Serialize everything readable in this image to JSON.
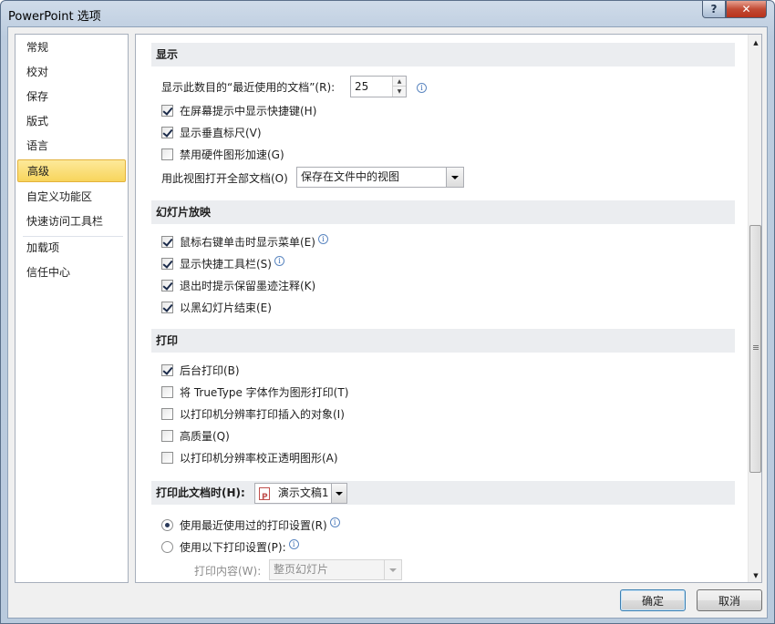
{
  "window": {
    "title": "PowerPoint 选项",
    "help_label": "?",
    "close_label": "✕"
  },
  "nav": {
    "items": [
      "常规",
      "校对",
      "保存",
      "版式",
      "语言",
      "高级",
      "自定义功能区",
      "快速访问工具栏",
      "加载项",
      "信任中心"
    ],
    "active": "高级"
  },
  "display": {
    "heading": "显示",
    "recent_docs_label": "显示此数目的“最近使用的文档”(R):",
    "recent_docs_value": "25",
    "options": [
      {
        "label": "在屏幕提示中显示快捷键(H)",
        "checked": true
      },
      {
        "label": "显示垂直标尺(V)",
        "checked": true
      },
      {
        "label": "禁用硬件图形加速(G)",
        "checked": false
      }
    ],
    "open_view_label": "用此视图打开全部文档(O)",
    "open_view_value": "保存在文件中的视图"
  },
  "slideshow": {
    "heading": "幻灯片放映",
    "options": [
      {
        "label": "鼠标右键单击时显示菜单(E)",
        "checked": true,
        "info": true
      },
      {
        "label": "显示快捷工具栏(S)",
        "checked": true,
        "info": true
      },
      {
        "label": "退出时提示保留墨迹注释(K)",
        "checked": true,
        "info": false
      },
      {
        "label": "以黑幻灯片结束(E)",
        "checked": true,
        "info": false
      }
    ]
  },
  "print": {
    "heading": "打印",
    "options": [
      {
        "label": "后台打印(B)",
        "checked": true
      },
      {
        "label": "将 TrueType 字体作为图形打印(T)",
        "checked": false
      },
      {
        "label": "以打印机分辨率打印插入的对象(I)",
        "checked": false
      },
      {
        "label": "高质量(Q)",
        "checked": false
      },
      {
        "label": "以打印机分辨率校正透明图形(A)",
        "checked": false
      }
    ]
  },
  "print_doc": {
    "heading": "打印此文档时(H):",
    "doc_value": "演示文稿1",
    "radio_recent": "使用最近使用过的打印设置(R)",
    "radio_following": "使用以下打印设置(P):",
    "selected": "recent",
    "content_label": "打印内容(W):",
    "content_value": "整页幻灯片"
  },
  "buttons": {
    "ok": "确定",
    "cancel": "取消"
  },
  "info_glyph": "i",
  "spin_up_glyph": "▲",
  "spin_down_glyph": "▼",
  "scroll_up_glyph": "▲",
  "scroll_down_glyph": "▼"
}
